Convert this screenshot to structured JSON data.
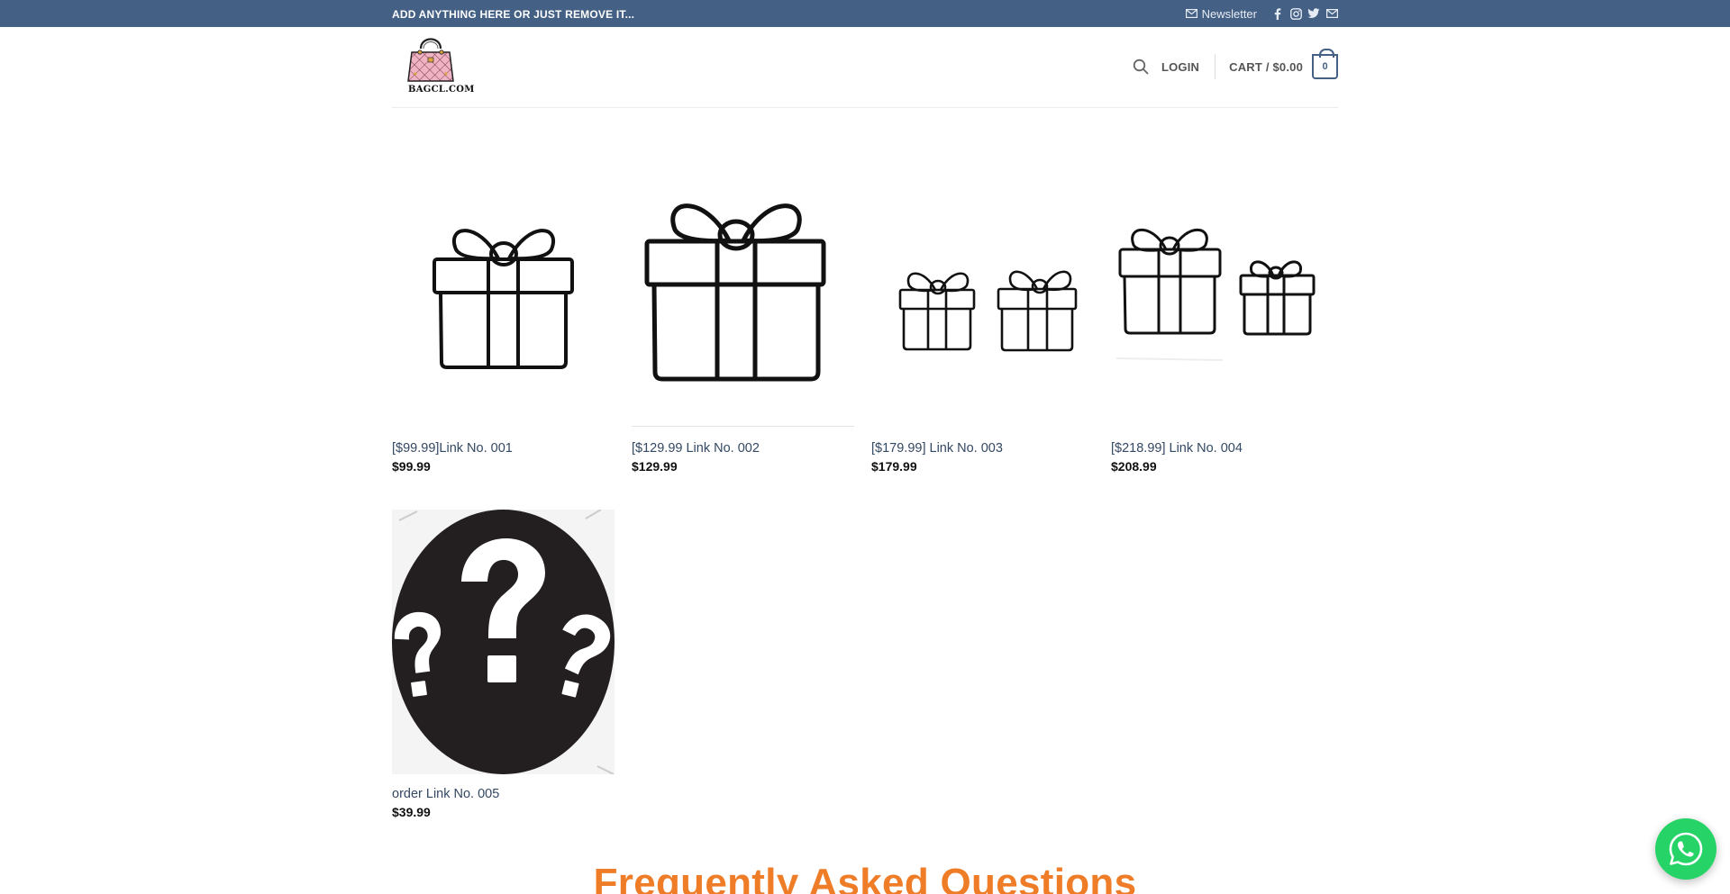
{
  "topbar": {
    "promo": "ADD ANYTHING HERE OR JUST REMOVE IT...",
    "newsletter_label": "Newsletter",
    "socials": [
      "facebook-icon",
      "instagram-icon",
      "twitter-icon",
      "email-icon"
    ]
  },
  "header": {
    "logo_text": "BAGCL.COM",
    "login_label": "LOGIN",
    "cart_label": "CART / $0.00",
    "cart_count": "0"
  },
  "products": [
    {
      "title": "[$99.99]Link No. 001",
      "price": "$99.99",
      "image": "gift-box-icon"
    },
    {
      "title": "[$129.99 Link No. 002",
      "price": "$129.99",
      "image": "gift-box-icon"
    },
    {
      "title": "[$179.99] Link No. 003",
      "price": "$179.99",
      "image": "two-gift-boxes-icon"
    },
    {
      "title": "[$218.99] Link No. 004",
      "price": "$208.99",
      "image": "two-gift-boxes-icon"
    },
    {
      "title": "order Link No. 005",
      "price": "$39.99",
      "image": "question-marks-circle"
    }
  ],
  "faq_heading": "Frequently Asked Questions",
  "colors": {
    "topbar": "#446084",
    "accent_orange": "#ef7d27",
    "whatsapp": "#25d366",
    "link": "#334862"
  }
}
